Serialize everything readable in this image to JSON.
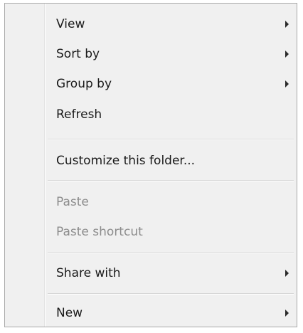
{
  "context_menu": {
    "items": [
      {
        "label": "View",
        "has_submenu": true,
        "enabled": true
      },
      {
        "label": "Sort by",
        "has_submenu": true,
        "enabled": true
      },
      {
        "label": "Group by",
        "has_submenu": true,
        "enabled": true
      },
      {
        "label": "Refresh",
        "has_submenu": false,
        "enabled": true
      },
      {
        "label": "Customize this folder...",
        "has_submenu": false,
        "enabled": true
      },
      {
        "label": "Paste",
        "has_submenu": false,
        "enabled": false
      },
      {
        "label": "Paste shortcut",
        "has_submenu": false,
        "enabled": false
      },
      {
        "label": "Share with",
        "has_submenu": true,
        "enabled": true
      },
      {
        "label": "New",
        "has_submenu": true,
        "enabled": true
      }
    ],
    "colors": {
      "background": "#f0f0f0",
      "border": "#a9a9a9",
      "text": "#1a1a1a",
      "disabled_text": "#8d8d8d",
      "separator": "#d7d7d7"
    }
  }
}
